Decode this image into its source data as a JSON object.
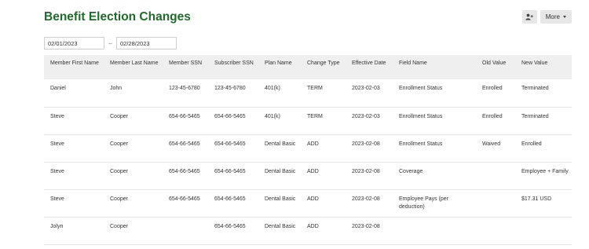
{
  "page": {
    "title": "Benefit Election Changes"
  },
  "toolbar": {
    "more_label": "More"
  },
  "filters": {
    "start_date": "02/01/2023",
    "separator": "–",
    "end_date": "02/28/2023"
  },
  "table": {
    "columns": [
      {
        "key": "member_first_name",
        "label": "Member First Name"
      },
      {
        "key": "member_last_name",
        "label": "Member Last Name"
      },
      {
        "key": "member_ssn",
        "label": "Member SSN"
      },
      {
        "key": "subscriber_ssn",
        "label": "Subscriber SSN"
      },
      {
        "key": "plan_name",
        "label": "Plan Name"
      },
      {
        "key": "change_type",
        "label": "Change Type"
      },
      {
        "key": "effective_date",
        "label": "Effective Date"
      },
      {
        "key": "field_name",
        "label": "Field Name"
      },
      {
        "key": "old_value",
        "label": "Old Value"
      },
      {
        "key": "new_value",
        "label": "New Value"
      }
    ],
    "rows": [
      {
        "member_first_name": "Daniel",
        "member_last_name": "John",
        "member_ssn": "123-45-6780",
        "subscriber_ssn": "123-45-6780",
        "plan_name": "401(k)",
        "change_type": "TERM",
        "effective_date": "2023-02-03",
        "field_name": "Enrollment Status",
        "old_value": "Enrolled",
        "new_value": "Terminated"
      },
      {
        "member_first_name": "Steve",
        "member_last_name": "Cooper",
        "member_ssn": "654-66-5465",
        "subscriber_ssn": "654-66-5465",
        "plan_name": "401(k)",
        "change_type": "TERM",
        "effective_date": "2023-02-03",
        "field_name": "Enrollment Status",
        "old_value": "Enrolled",
        "new_value": "Terminated"
      },
      {
        "member_first_name": "Steve",
        "member_last_name": "Cooper",
        "member_ssn": "654-66-5465",
        "subscriber_ssn": "654-66-5465",
        "plan_name": "Dental Basic",
        "change_type": "ADD",
        "effective_date": "2023-02-08",
        "field_name": "Enrollment Status",
        "old_value": "Waived",
        "new_value": "Enrolled"
      },
      {
        "member_first_name": "Steve",
        "member_last_name": "Cooper",
        "member_ssn": "654-66-5465",
        "subscriber_ssn": "654-66-5465",
        "plan_name": "Dental Basic",
        "change_type": "ADD",
        "effective_date": "2023-02-08",
        "field_name": "Coverage",
        "old_value": "",
        "new_value": "Employee + Family"
      },
      {
        "member_first_name": "Steve",
        "member_last_name": "Cooper",
        "member_ssn": "654-66-5465",
        "subscriber_ssn": "654-66-5465",
        "plan_name": "Dental Basic",
        "change_type": "ADD",
        "effective_date": "2023-02-08",
        "field_name": "Employee Pays (per deduction)",
        "old_value": "",
        "new_value": "$17.31 USD"
      },
      {
        "member_first_name": "Jolyn",
        "member_last_name": "Cooper",
        "member_ssn": "",
        "subscriber_ssn": "654-66-5465",
        "plan_name": "Dental Basic",
        "change_type": "ADD",
        "effective_date": "2023-02-08",
        "field_name": "",
        "old_value": "",
        "new_value": ""
      }
    ]
  }
}
